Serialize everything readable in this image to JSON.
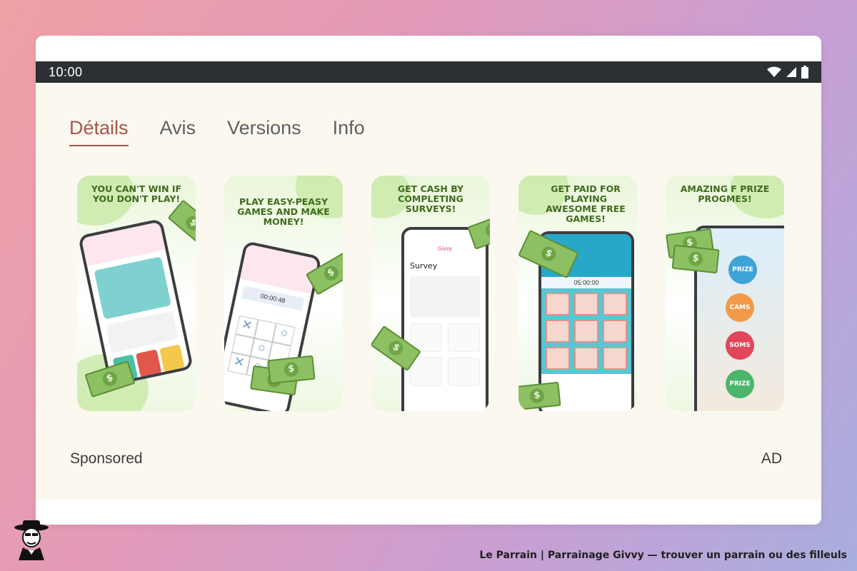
{
  "status_bar": {
    "time": "10:00",
    "icons": [
      "wifi-icon",
      "signal-icon",
      "battery-icon"
    ]
  },
  "tabs": [
    {
      "label": "Détails",
      "active": true
    },
    {
      "label": "Avis",
      "active": false
    },
    {
      "label": "Versions",
      "active": false
    },
    {
      "label": "Info",
      "active": false
    }
  ],
  "screenshots": [
    {
      "caption": "YOU CAN'T WIN IF YOU DON'T PLAY!"
    },
    {
      "caption": "PLAY EASY-PEASY GAMES AND MAKE MONEY!",
      "timer": "00:00:48"
    },
    {
      "caption": "GET CASH BY COMPLETING SURVEYS!",
      "title": "Survey",
      "brand": "Givvy"
    },
    {
      "caption": "GET PAID FOR PLAYING AWESOME FREE GAMES!",
      "timer": "05:00:00"
    },
    {
      "caption": "AMAZING F PRIZE PROGMES!",
      "buttons": [
        "PRIZE",
        "CAMS",
        "SOMS",
        "PRIZE"
      ]
    }
  ],
  "sponsored_label": "Sponsored",
  "ad_label": "AD",
  "attribution": "Le Parrain | Parrainage Givvy — trouver un parrain ou des filleuls",
  "colors": {
    "accent": "#a3584a",
    "status_bar": "#2c2f33",
    "caption_green": "#3f6b1e",
    "money_green": "#8cc063"
  }
}
